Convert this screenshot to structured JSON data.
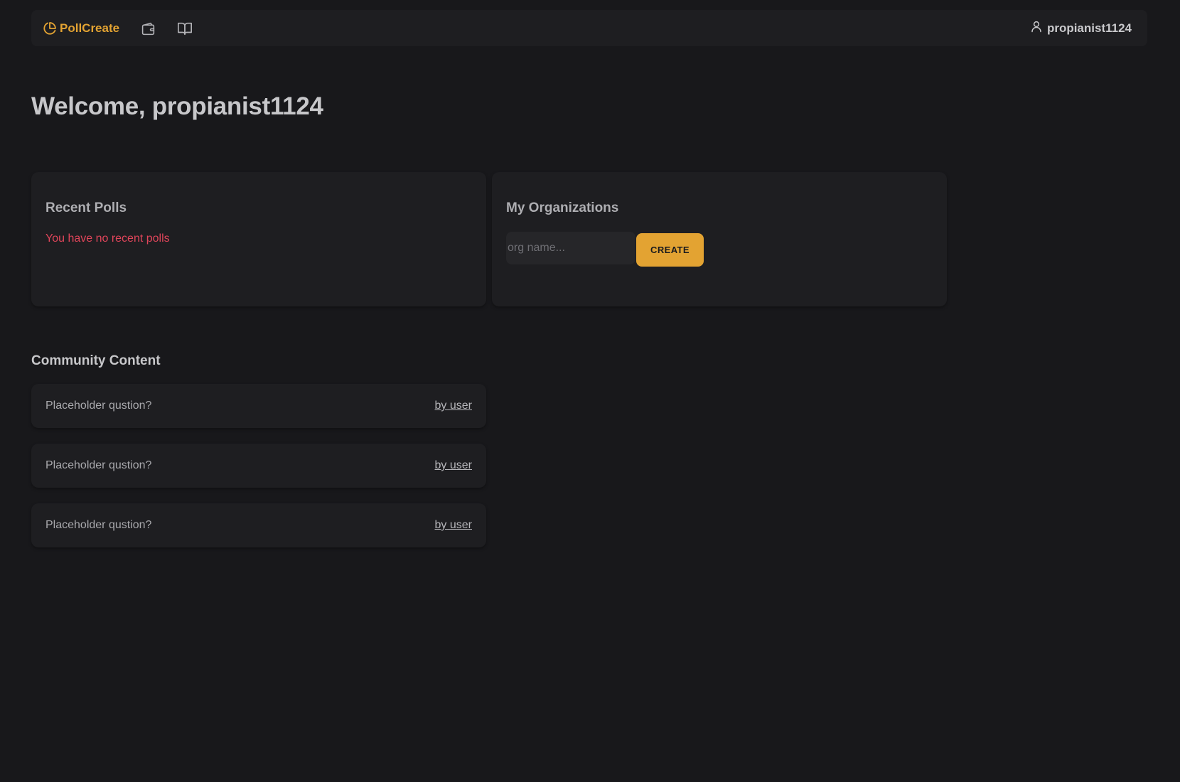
{
  "nav": {
    "brand": "PollCreate",
    "brand_icon": "pie-chart-icon",
    "icons": [
      "wallet-icon",
      "book-open-icon"
    ],
    "user_icon": "user-icon",
    "username": "propianist1124"
  },
  "welcome": "Welcome, propianist1124",
  "recent_polls": {
    "title": "Recent Polls",
    "empty_message": "You have no recent polls"
  },
  "organizations": {
    "title": "My Organizations",
    "input_placeholder": "org name...",
    "input_value": "",
    "create_label": "CREATE"
  },
  "community": {
    "title": "Community Content",
    "items": [
      {
        "question": "Placeholder qustion?",
        "author": "by user"
      },
      {
        "question": "Placeholder qustion?",
        "author": "by user"
      },
      {
        "question": "Placeholder qustion?",
        "author": "by user"
      }
    ]
  },
  "colors": {
    "accent": "#e3a332",
    "background": "#18181b",
    "card": "#1e1e21",
    "error": "#e0455a"
  }
}
